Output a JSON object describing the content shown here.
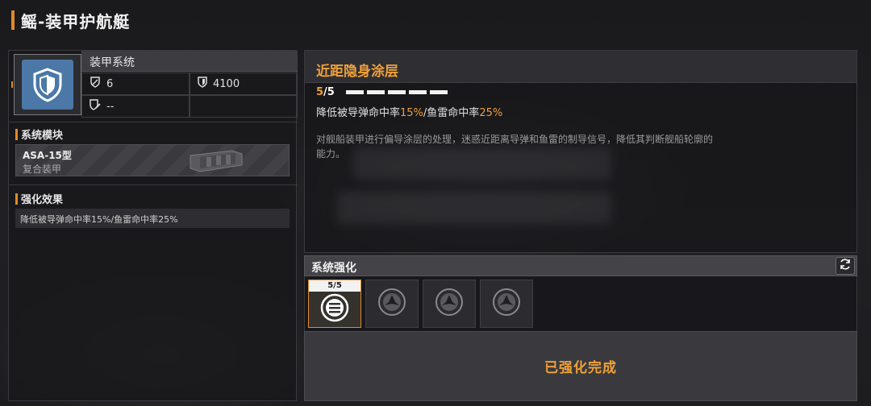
{
  "page": {
    "title": "鳐-装甲护航艇"
  },
  "armor": {
    "name": "装甲系统",
    "icon": "shield-icon",
    "stats": [
      {
        "icon": "sword-shield-icon",
        "value": "6"
      },
      {
        "icon": "shield-small-icon",
        "value": "4100"
      },
      {
        "icon": "shield-edit-icon",
        "value": "--"
      },
      {
        "icon": "",
        "value": ""
      }
    ]
  },
  "module": {
    "section_title": "系统模块",
    "name": "ASA-15型",
    "type": "复合装甲"
  },
  "enhancement": {
    "section_title": "强化效果",
    "text": "降低被导弹命中率15%/鱼雷命中率25%"
  },
  "detail": {
    "title": "近距隐身涂层",
    "level_current": "5",
    "level_sep": "/",
    "level_max": "5",
    "level_progress": 1.0,
    "pips": 5,
    "effect_parts": [
      "降低被导弹命中率",
      "15%",
      "/鱼雷命中率",
      "25%"
    ],
    "description": "对舰船装甲进行偏导涂层的处理，迷惑近距离导弹和鱼雷的制导信号，降低其判断舰船轮廓的能力。"
  },
  "upgrade": {
    "title": "系统强化",
    "refresh_icon": "refresh-icon",
    "slots": [
      {
        "level": "5/5",
        "active": true,
        "icon": "list-circle-icon"
      },
      {
        "level": "",
        "active": false,
        "icon": "ship-emblem-icon"
      },
      {
        "level": "",
        "active": false,
        "icon": "ship-emblem-icon"
      },
      {
        "level": "",
        "active": false,
        "icon": "ship-emblem-icon"
      }
    ],
    "status": "已强化完成"
  },
  "colors": {
    "accent": "#f0a038",
    "accent_bar": "#e08a2a",
    "armor_icon_bg": "#4b78a6"
  }
}
